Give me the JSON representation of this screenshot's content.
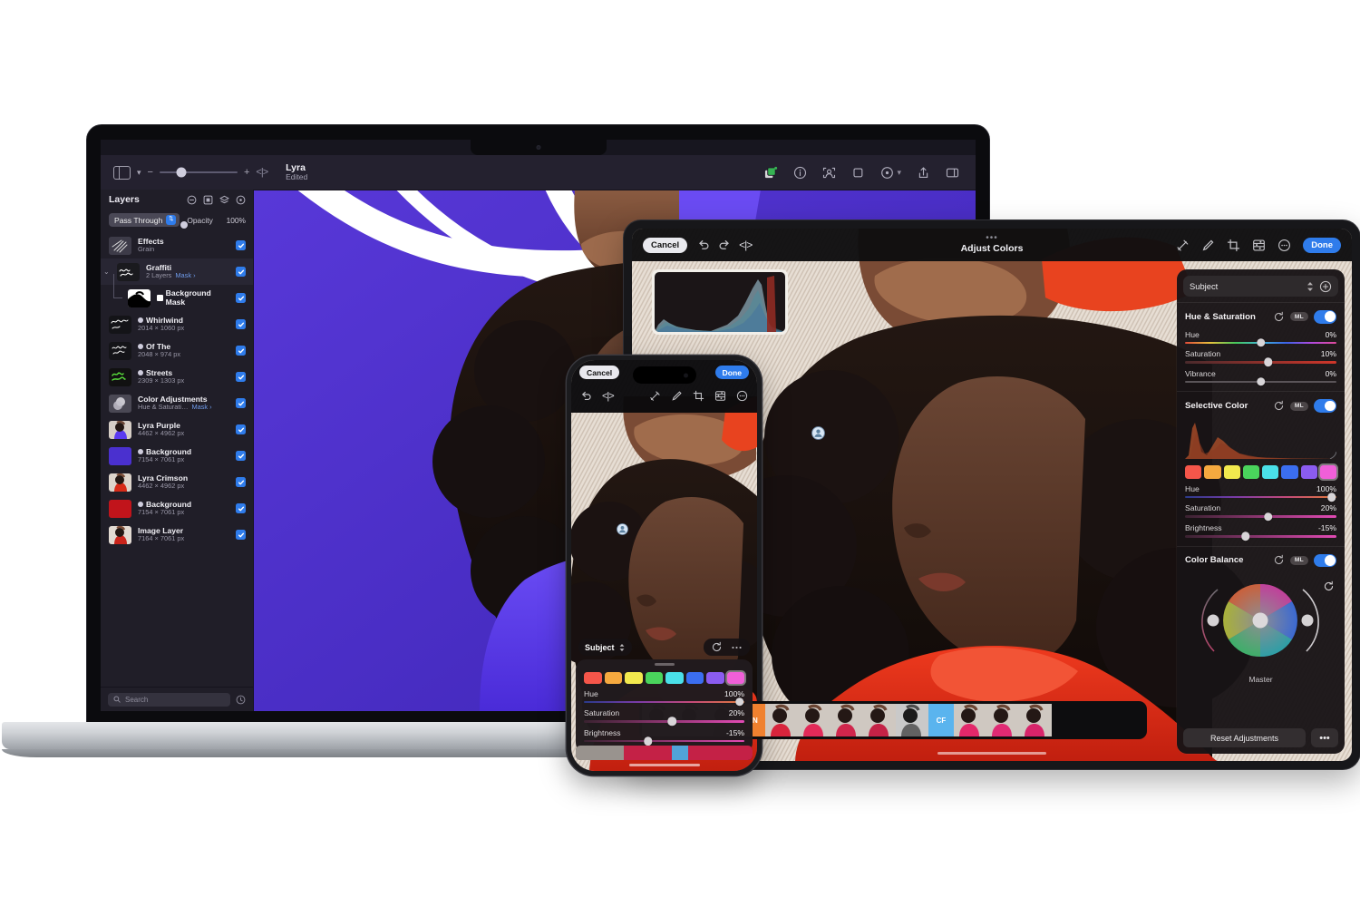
{
  "macbook": {
    "toolbar": {
      "sidebar_toggle_icon": "sidebar-toggle-icon",
      "chevron_icon": "chevron-down-icon",
      "zoom_out_label": "−",
      "zoom_in_label": "+",
      "compare_label": "<|>",
      "doc_title": "Lyra",
      "doc_status": "Edited",
      "right_icons": [
        "add-layer-icon",
        "info-icon",
        "subject-select-icon",
        "crop-icon",
        "adjust-icon",
        "share-icon",
        "inspector-icon"
      ]
    },
    "layers_panel": {
      "title": "Layers",
      "header_icons": [
        "remove-layer-icon",
        "mask-icon",
        "group-icon",
        "adjustment-icon"
      ],
      "blend_mode": "Pass Through",
      "opacity_label": "Opacity",
      "opacity_value": "100%",
      "search_placeholder": "Search",
      "search_icon": "search-icon",
      "filter_icon": "filter-icon",
      "layers": [
        {
          "name": "Effects",
          "sub": "Grain",
          "checked": true,
          "thumb": "effects",
          "type": "plain"
        },
        {
          "name": "Graffiti",
          "sub": "2 Layers",
          "mask": "Mask",
          "checked": true,
          "thumb": "graffiti",
          "type": "group-open"
        },
        {
          "name": "Background Mask",
          "sub": "",
          "checked": true,
          "thumb": "bgmask",
          "type": "child"
        },
        {
          "name": "Whirlwind",
          "sub": "2014 × 1060 px",
          "checked": true,
          "thumb": "whirlwind",
          "type": "linked"
        },
        {
          "name": "Of The",
          "sub": "2048 × 974 px",
          "checked": true,
          "thumb": "ofthe",
          "type": "linked"
        },
        {
          "name": "Streets",
          "sub": "2309 × 1303 px",
          "checked": true,
          "thumb": "streets",
          "type": "linked"
        },
        {
          "name": "Color Adjustments",
          "sub": "Hue & Saturati…",
          "mask": "Mask",
          "checked": true,
          "thumb": "coloradj",
          "type": "plain"
        },
        {
          "name": "Lyra Purple",
          "sub": "4462 × 4962 px",
          "checked": true,
          "thumb": "lyrapurple",
          "type": "plain"
        },
        {
          "name": "Background",
          "sub": "7154 × 7061 px",
          "checked": true,
          "thumb": "bgpurple",
          "type": "linked"
        },
        {
          "name": "Lyra Crimson",
          "sub": "4462 × 4962 px",
          "checked": true,
          "thumb": "lyracrimson",
          "type": "plain"
        },
        {
          "name": "Background",
          "sub": "7154 × 7061 px",
          "checked": true,
          "thumb": "bgred",
          "type": "linked"
        },
        {
          "name": "Image Layer",
          "sub": "7164 × 7061 px",
          "checked": true,
          "thumb": "imagelayer",
          "type": "plain"
        }
      ]
    }
  },
  "ipad": {
    "topbar": {
      "cancel_label": "Cancel",
      "undo_icon": "undo-icon",
      "redo_icon": "redo-icon",
      "compare_icon": "compare-icon",
      "overflow_dots": "•••",
      "title": "Adjust Colors",
      "done_label": "Done",
      "tools": [
        "retouch-ml-icon",
        "brush-icon",
        "crop-icon",
        "adjust-sliders-icon",
        "more-circle-icon"
      ]
    },
    "panel": {
      "subject_label": "Subject",
      "subject_stepper_icon": "up-down-chevron-icon",
      "add_icon": "plus-circle-icon",
      "sections": [
        {
          "title": "Hue & Saturation",
          "reset_icon": "reset-icon",
          "ml_badge": "ML",
          "enabled": true,
          "sliders": [
            {
              "label": "Hue",
              "value": "0%",
              "pos": 50,
              "track": "hue"
            },
            {
              "label": "Saturation",
              "value": "10%",
              "pos": 55,
              "track": "sat"
            },
            {
              "label": "Vibrance",
              "value": "0%",
              "pos": 50,
              "track": "plain"
            }
          ]
        },
        {
          "title": "Selective Color",
          "reset_icon": "reset-icon",
          "ml_badge": "ML",
          "enabled": true,
          "swatches": [
            "#f5564a",
            "#f5a93f",
            "#f2e94e",
            "#4ad45c",
            "#4ae0e8",
            "#3b6ef0",
            "#8b5cf0",
            "#f05fd8"
          ],
          "active_swatch": 7,
          "sliders": [
            {
              "label": "Hue",
              "value": "100%",
              "pos": 97,
              "track": "selhue"
            },
            {
              "label": "Saturation",
              "value": "20%",
              "pos": 55,
              "track": "magenta"
            },
            {
              "label": "Brightness",
              "value": "-15%",
              "pos": 40,
              "track": "magenta"
            }
          ]
        },
        {
          "title": "Color Balance",
          "reset_icon": "reset-icon",
          "ml_badge": "ML",
          "enabled": true,
          "wheel_label": "Master",
          "wheel_reset_icon": "reset-icon"
        }
      ],
      "reset_button": "Reset Adjustments",
      "more_button": "•••"
    },
    "filmstrip": {
      "group_labels": [
        {
          "text": "CN",
          "color": "#f0812f",
          "index": 3
        },
        {
          "text": "CF",
          "color": "#5ab4ee",
          "index": 9
        }
      ],
      "thumb_count": 12
    },
    "subject_badge_icon": "person-badge-icon"
  },
  "iphone": {
    "topbar": {
      "cancel_label": "Cancel",
      "done_label": "Done",
      "undo_icon": "undo-icon",
      "compare_icon": "compare-icon",
      "tools": [
        "retouch-ml-icon",
        "brush-icon",
        "crop-icon",
        "adjust-sliders-icon",
        "more-circle-icon"
      ]
    },
    "subject_label": "Subject",
    "subject_stepper_icon": "up-down-chevron-icon",
    "reset_icon": "reset-icon",
    "more_icon": "more-dots-icon",
    "swatches": [
      "#f5564a",
      "#f5a93f",
      "#f2e94e",
      "#4ad45c",
      "#4ae0e8",
      "#3b6ef0",
      "#8b5cf0",
      "#f05fd8"
    ],
    "active_swatch": 7,
    "sliders": [
      {
        "label": "Hue",
        "value": "100%",
        "pos": 97,
        "track": "selhue"
      },
      {
        "label": "Saturation",
        "value": "20%",
        "pos": 55,
        "track": "magenta"
      },
      {
        "label": "Brightness",
        "value": "-15%",
        "pos": 40,
        "track": "magenta"
      }
    ],
    "subject_badge_icon": "person-badge-icon"
  }
}
